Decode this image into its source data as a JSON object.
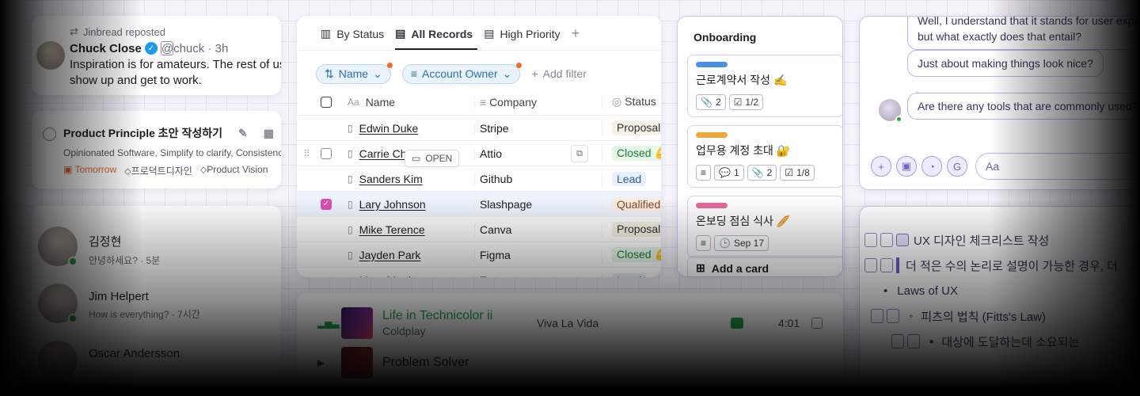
{
  "tweet": {
    "repost_label": "Jinbread reposted",
    "name": "Chuck Close",
    "verified_glyph": "✓",
    "handle": "@chuck · 3h",
    "body": "Inspiration is for amateurs. The rest of us just\nshow up and get to work."
  },
  "task": {
    "title": "Product Principle 초안 작성하기",
    "description": "Opinionated Software, Simplify to clarify, Consistency",
    "due": "Tomorrow",
    "tags": [
      "프로덕트디자인",
      "Product Vision"
    ]
  },
  "chats": [
    {
      "name": "김정현",
      "preview": "안녕하세요? · 5분"
    },
    {
      "name": "Jim Helpert",
      "preview": "How is everything? · 7시간"
    },
    {
      "name": "Oscar Andersson",
      "preview": ""
    }
  ],
  "records": {
    "tabs": [
      {
        "label": "By Status",
        "icon": "board-icon"
      },
      {
        "label": "All Records",
        "icon": "table-icon"
      },
      {
        "label": "High Priority",
        "icon": "table-icon"
      }
    ],
    "add_tab": "+",
    "filters": [
      {
        "label": "Name",
        "icon": "sort-icon"
      },
      {
        "label": "Account Owner",
        "icon": "filter-icon"
      }
    ],
    "add_filter": "Add filter",
    "columns": {
      "name": "Name",
      "company": "Company",
      "status": "Status"
    },
    "name_icon": "Aa",
    "open_label": "OPEN",
    "rows": [
      {
        "name": "Edwin Duke",
        "company": "Stripe",
        "status": "Proposal 👀",
        "status_bg": "#f6f1e6",
        "status_fg": "#333",
        "checked": false
      },
      {
        "name": "Carrie Chang",
        "company": "Attio",
        "status": "Closed 💪",
        "status_bg": "#e6f6e8",
        "status_fg": "#1f7a34",
        "checked": false
      },
      {
        "name": "Sanders Kim",
        "company": "Github",
        "status": "Lead",
        "status_bg": "#e8f1fb",
        "status_fg": "#2a5f9e",
        "checked": false
      },
      {
        "name": "Lary Johnson",
        "company": "Slashpage",
        "status": "Qualified",
        "status_bg": "#fbeee4",
        "status_fg": "#8a4a1c",
        "checked": true
      },
      {
        "name": "Mike Terence",
        "company": "Canva",
        "status": "Proposal 👀",
        "status_bg": "#f6f1e6",
        "status_fg": "#333",
        "checked": false
      },
      {
        "name": "Jayden Park",
        "company": "Figma",
        "status": "Closed 💪",
        "status_bg": "#e6f6e8",
        "status_fg": "#1f7a34",
        "checked": false
      },
      {
        "name": "Mary Meeks",
        "company": "Framer",
        "status": "Lead",
        "status_bg": "#e8f1fb",
        "status_fg": "#2a5f9e",
        "checked": false
      }
    ]
  },
  "kanban": {
    "column_title": "Onboarding",
    "cards": [
      {
        "title": "근로계약서 작성 ✍️",
        "bar_color": "#4a90e2",
        "meta": [
          {
            "icon": "📎",
            "value": "2"
          },
          {
            "icon": "☑",
            "value": "1/2"
          }
        ]
      },
      {
        "title": "업무용 계정 초대 🔐",
        "bar_color": "#f0a63a",
        "meta": [
          {
            "icon": "≡",
            "value": ""
          },
          {
            "icon": "💬",
            "value": "1"
          },
          {
            "icon": "📎",
            "value": "2"
          },
          {
            "icon": "☑",
            "value": "1/8"
          }
        ]
      },
      {
        "title": "온보딩 점심 식사 🥖",
        "bar_color": "#e86a9a",
        "meta": [
          {
            "icon": "≡",
            "value": ""
          },
          {
            "icon": "🕒",
            "value": "Sep 17"
          }
        ]
      }
    ],
    "add_card": "Add a card"
  },
  "conversation": {
    "messages": [
      "Well, I understand that it stands for user experience,\nbut what exactly does that entail?",
      "Just about making things look nice?",
      "Are there any tools that are commonly used?"
    ],
    "input_placeholder": "Aa",
    "tool_icons": [
      "plus-icon",
      "image-icon",
      "sticker-icon",
      "gif-icon"
    ]
  },
  "checklist": {
    "items": [
      "UX 디자인 체크리스트 작성",
      "더 적은 수의 논리로 설명이 가능한 경우, 더",
      "Laws of UX",
      "피츠의 법칙 (Fitts's Law)",
      "대상에 도달하는데 소요되는"
    ]
  },
  "music": {
    "tracks": [
      {
        "title": "Life in Technicolor ii",
        "artist": "Coldplay",
        "album": "Viva La Vida",
        "duration": "4:01",
        "playing": true
      },
      {
        "title": "Problem Solver",
        "artist": "",
        "album": "",
        "duration": "",
        "playing": false
      }
    ]
  }
}
